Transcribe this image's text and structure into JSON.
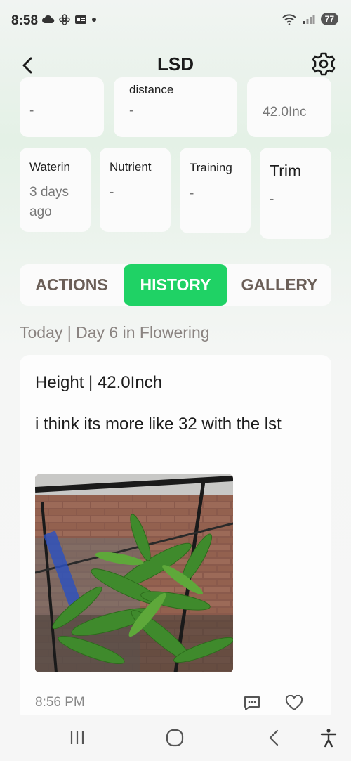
{
  "status_bar": {
    "time": "8:58",
    "battery": "77"
  },
  "header": {
    "title": "LSD"
  },
  "stats_row_1": [
    {
      "title": "",
      "value": "-"
    },
    {
      "title": "distance",
      "value": "-"
    },
    {
      "title": "",
      "value": "42.0Inc"
    }
  ],
  "stats_row_2": [
    {
      "title": "Waterin",
      "value": "3 days ago"
    },
    {
      "title": "Nutrient",
      "value": "-"
    },
    {
      "title": "Training",
      "value": "-"
    },
    {
      "title": "Trim",
      "value": "-"
    }
  ],
  "tabs": [
    {
      "label": "ACTIONS",
      "active": false
    },
    {
      "label": "HISTORY",
      "active": true
    },
    {
      "label": "GALLERY",
      "active": false
    }
  ],
  "history": {
    "section_label": "Today | Day 6 in Flowering",
    "entry": {
      "title": "Height | 42.0Inch",
      "note": "i think its more like 32 with the lst",
      "time": "8:56 PM"
    }
  },
  "colors": {
    "accent": "#1fd265",
    "tab_text": "#6a5e57"
  }
}
